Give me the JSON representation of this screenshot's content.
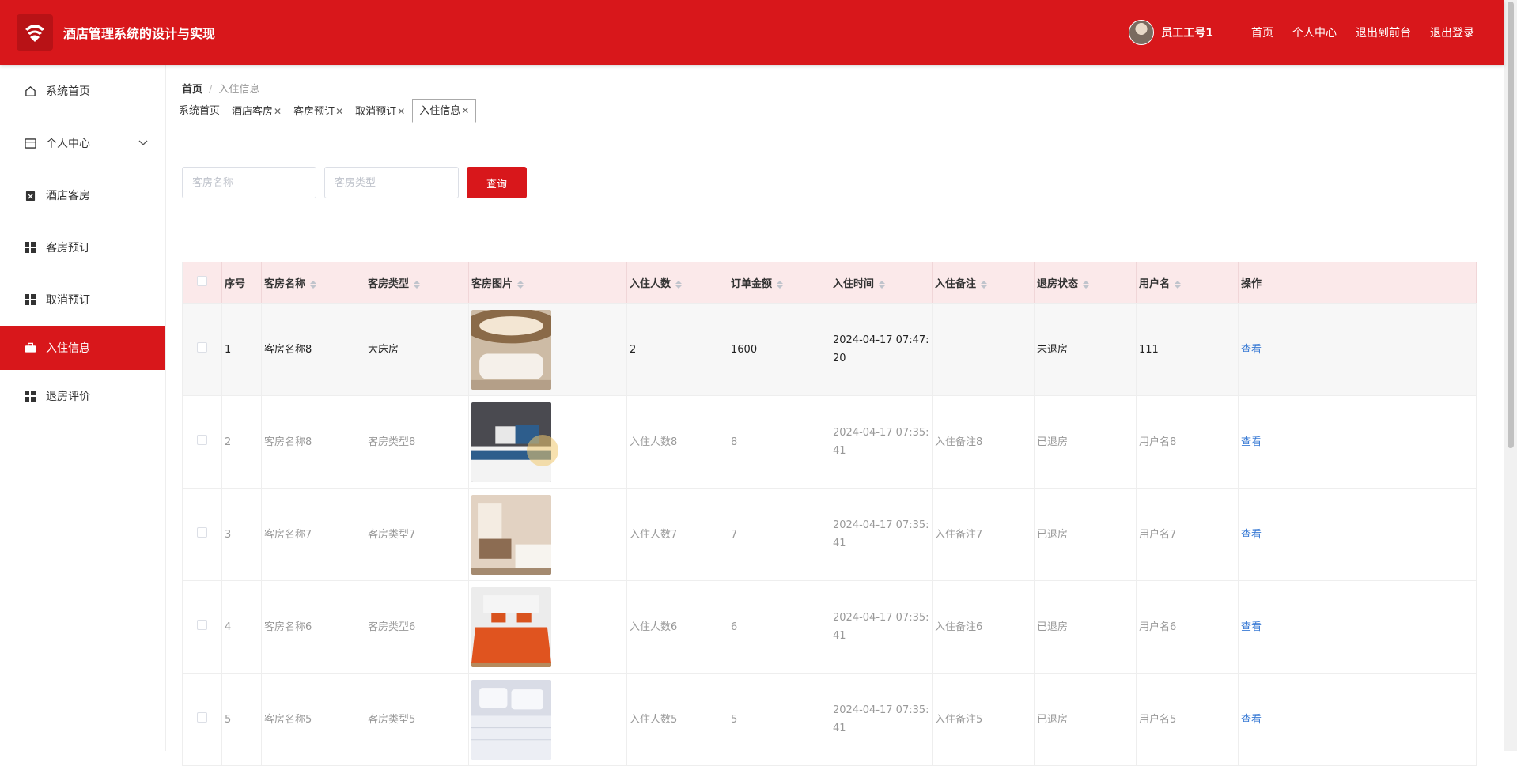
{
  "header": {
    "title": "酒店管理系统的设计与实现",
    "username": "员工工号1",
    "nav": [
      "首页",
      "个人中心",
      "退出到前台",
      "退出登录"
    ]
  },
  "sidebar": {
    "items": [
      {
        "label": "系统首页",
        "icon": "home-icon"
      },
      {
        "label": "个人中心",
        "icon": "card-icon"
      },
      {
        "label": "酒店客房",
        "icon": "clipboard-icon"
      },
      {
        "label": "客房预订",
        "icon": "grid-icon"
      },
      {
        "label": "取消预订",
        "icon": "grid-icon"
      },
      {
        "label": "入住信息",
        "icon": "briefcase-icon"
      },
      {
        "label": "退房评价",
        "icon": "grid-icon"
      }
    ],
    "active_index": 5
  },
  "breadcrumb": {
    "home": "首页",
    "current": "入住信息"
  },
  "tabs": [
    {
      "label": "系统首页",
      "closable": false
    },
    {
      "label": "酒店客房",
      "closable": true
    },
    {
      "label": "客房预订",
      "closable": true
    },
    {
      "label": "取消预订",
      "closable": true
    },
    {
      "label": "入住信息",
      "closable": true,
      "active": true
    }
  ],
  "search": {
    "room_name_placeholder": "客房名称",
    "room_type_placeholder": "客房类型",
    "button_label": "查询"
  },
  "table": {
    "columns": [
      "序号",
      "客房名称",
      "客房类型",
      "客房图片",
      "入住人数",
      "订单金额",
      "入住时间",
      "入住备注",
      "退房状态",
      "用户名",
      "操作"
    ],
    "rows": [
      {
        "no": "1",
        "name": "客房名称8",
        "type": "大床房",
        "guests": "2",
        "amount": "1600",
        "time": "2024-04-17 07:47:20",
        "note": "",
        "status": "未退房",
        "user": "111",
        "action": "查看",
        "img": "lobby"
      },
      {
        "no": "2",
        "name": "客房名称8",
        "type": "客房类型8",
        "guests": "入住人数8",
        "amount": "8",
        "time": "2024-04-17 07:35:41",
        "note": "入住备注8",
        "status": "已退房",
        "user": "用户名8",
        "action": "查看",
        "img": "blue-bed"
      },
      {
        "no": "3",
        "name": "客房名称7",
        "type": "客房类型7",
        "guests": "入住人数7",
        "amount": "7",
        "time": "2024-04-17 07:35:41",
        "note": "入住备注7",
        "status": "已退房",
        "user": "用户名7",
        "action": "查看",
        "img": "beige-room"
      },
      {
        "no": "4",
        "name": "客房名称6",
        "type": "客房类型6",
        "guests": "入住人数6",
        "amount": "6",
        "time": "2024-04-17 07:35:41",
        "note": "入住备注6",
        "status": "已退房",
        "user": "用户名6",
        "action": "查看",
        "img": "orange-bed"
      },
      {
        "no": "5",
        "name": "客房名称5",
        "type": "客房类型5",
        "guests": "入住人数5",
        "amount": "5",
        "time": "2024-04-17 07:35:41",
        "note": "入住备注5",
        "status": "已退房",
        "user": "用户名5",
        "action": "查看",
        "img": "white-bed"
      }
    ]
  },
  "colors": {
    "primary": "#d8171b",
    "header_row": "#fbe9ea",
    "link": "#3a7bd5"
  }
}
